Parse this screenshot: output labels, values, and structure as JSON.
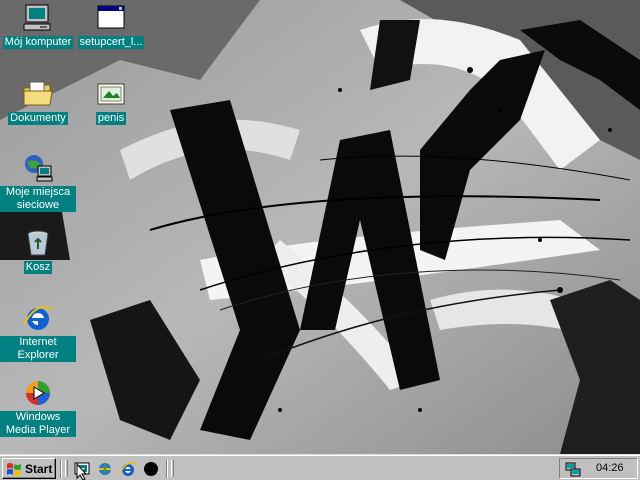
{
  "desktop": {
    "icons": [
      {
        "label": "Mój komputer",
        "icon": "my-computer-icon"
      },
      {
        "label": "setupcert_l...",
        "icon": "application-window-icon"
      },
      {
        "label": "Dokumenty",
        "icon": "documents-folder-icon"
      },
      {
        "label": "penis",
        "icon": "image-file-icon"
      },
      {
        "label": "Moje miejsca sieciowe",
        "icon": "network-places-icon"
      },
      {
        "label": "Kosz",
        "icon": "recycle-bin-icon"
      },
      {
        "label": "Internet Explorer",
        "icon": "internet-explorer-icon"
      },
      {
        "label": "Windows Media Player",
        "icon": "media-player-icon"
      }
    ],
    "label_background": "#008080"
  },
  "taskbar": {
    "start_label": "Start",
    "quick_launch": [
      "show-desktop-icon",
      "channels-icon",
      "internet-explorer-icon",
      "media-disc-icon"
    ],
    "tray": {
      "icon": "network-tray-icon",
      "clock": "04:26"
    },
    "background": "#c0c0c0"
  }
}
